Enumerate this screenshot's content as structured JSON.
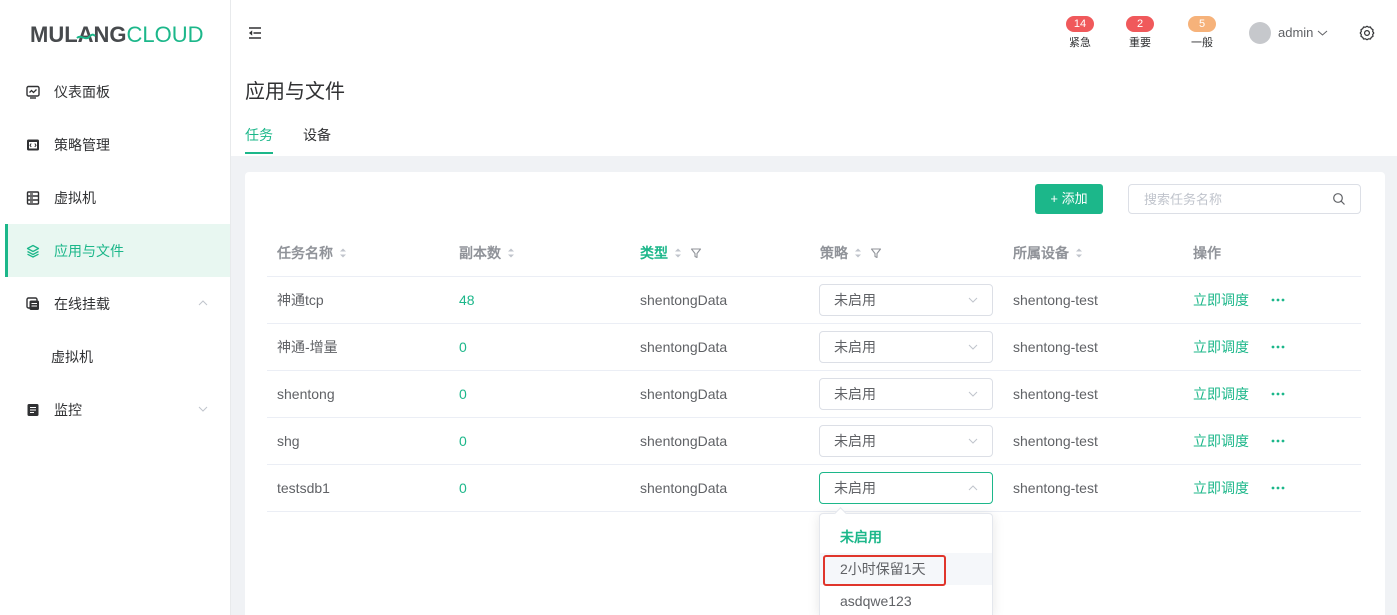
{
  "logo": {
    "text_dark": "MUL",
    "text_mark": "A",
    "text_dark2": "NG",
    "text_accent": "CLOUD"
  },
  "sidebar": {
    "items": [
      {
        "label": "仪表面板",
        "icon": "dashboard-icon"
      },
      {
        "label": "策略管理",
        "icon": "code-icon"
      },
      {
        "label": "虚拟机",
        "icon": "server-icon"
      },
      {
        "label": "应用与文件",
        "icon": "layers-icon",
        "active": true
      },
      {
        "label": "在线挂载",
        "icon": "copy-icon",
        "expanded": true
      },
      {
        "label": "虚拟机",
        "sub": true
      },
      {
        "label": "监控",
        "icon": "document-icon",
        "expanded": false
      }
    ]
  },
  "header": {
    "alerts": [
      {
        "count": 14,
        "label": "紧急",
        "color": "#f0595b"
      },
      {
        "count": 2,
        "label": "重要",
        "color": "#f0595b"
      },
      {
        "count": 5,
        "label": "一般",
        "color": "#f6b27a"
      }
    ],
    "user": {
      "name": "admin"
    }
  },
  "page": {
    "title": "应用与文件",
    "tabs": [
      {
        "label": "任务",
        "active": true
      },
      {
        "label": "设备",
        "active": false
      }
    ]
  },
  "toolbar": {
    "add_label": "+ 添加",
    "search_placeholder": "搜索任务名称"
  },
  "table": {
    "columns": [
      {
        "label": "任务名称",
        "sortable": true,
        "filterable": false
      },
      {
        "label": "副本数",
        "sortable": true,
        "filterable": false
      },
      {
        "label": "类型",
        "sortable": true,
        "filterable": true,
        "filter_active": true
      },
      {
        "label": "策略",
        "sortable": true,
        "filterable": true
      },
      {
        "label": "所属设备",
        "sortable": true,
        "filterable": false
      },
      {
        "label": "操作",
        "sortable": false,
        "filterable": false
      }
    ],
    "rows": [
      {
        "name": "神通tcp",
        "replicas": 48,
        "type": "shentongData",
        "policy": "未启用",
        "device": "shentong-test",
        "action": "立即调度"
      },
      {
        "name": "神通-增量",
        "replicas": 0,
        "type": "shentongData",
        "policy": "未启用",
        "device": "shentong-test",
        "action": "立即调度"
      },
      {
        "name": "shentong",
        "replicas": 0,
        "type": "shentongData",
        "policy": "未启用",
        "device": "shentong-test",
        "action": "立即调度"
      },
      {
        "name": "shg",
        "replicas": 0,
        "type": "shentongData",
        "policy": "未启用",
        "device": "shentong-test",
        "action": "立即调度"
      },
      {
        "name": "testsdb1",
        "replicas": 0,
        "type": "shentongData",
        "policy": "未启用",
        "device": "shentong-test",
        "action": "立即调度",
        "policy_open": true
      }
    ]
  },
  "policy_dropdown": {
    "open_on_row": 4,
    "options": [
      "未启用",
      "2小时保留1天",
      "asdqwe123"
    ],
    "selected_index": 0,
    "hovered_index": 1,
    "highlighted_index": 1
  },
  "colors": {
    "primary": "#1cb78a",
    "active_menu_bg": "#e8f7f1",
    "page_bg": "#f0f2f5",
    "highlight_border": "#e0352b"
  }
}
